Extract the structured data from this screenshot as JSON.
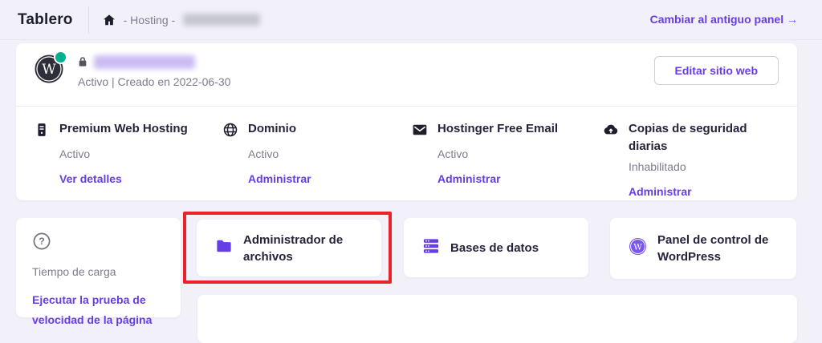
{
  "header": {
    "title": "Tablero",
    "breadcrumb_segment": "- Hosting -",
    "switch_panel_link": "Cambiar al antiguo panel →"
  },
  "site": {
    "status_line": "Activo | Creado en 2022-06-30",
    "edit_button": "Editar sitio web"
  },
  "services": [
    {
      "icon": "server-icon",
      "title": "Premium Web Hosting",
      "status": "Activo",
      "link": "Ver detalles"
    },
    {
      "icon": "globe-icon",
      "title": "Dominio",
      "status": "Activo",
      "link": "Administrar"
    },
    {
      "icon": "mail-icon",
      "title": "Hostinger Free Email",
      "status": "Activo",
      "link": "Administrar"
    },
    {
      "icon": "cloud-backup-icon",
      "title": "Copias de seguridad diarias",
      "status": "Inhabilitado",
      "link": "Administrar"
    }
  ],
  "cards": {
    "load_time": {
      "label": "Tiempo de carga",
      "link": "Ejecutar la prueba de velocidad de la página"
    },
    "file_manager": {
      "label": "Administrador de archivos",
      "highlighted": true
    },
    "databases": {
      "label": "Bases de datos"
    },
    "wordpress_panel": {
      "label": "Panel de control de WordPress"
    }
  },
  "colors": {
    "accent_purple": "#673de6",
    "highlight_red": "#e8232a",
    "status_green": "#00b090",
    "background": "#f2f1fa"
  }
}
